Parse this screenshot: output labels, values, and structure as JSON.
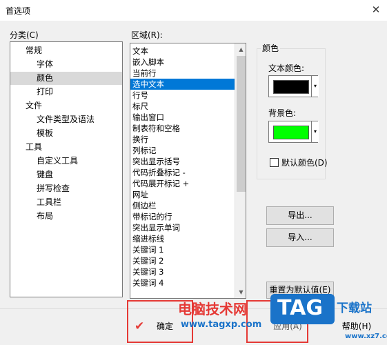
{
  "window": {
    "title": "首选项",
    "close_glyph": "✕"
  },
  "category": {
    "label": "分类(C)",
    "items": [
      {
        "label": "常规"
      },
      {
        "label": "字体"
      },
      {
        "label": "颜色"
      },
      {
        "label": "打印"
      },
      {
        "label": "文件"
      },
      {
        "label": "文件类型及语法"
      },
      {
        "label": "模板"
      },
      {
        "label": "工具"
      },
      {
        "label": "自定义工具"
      },
      {
        "label": "键盘"
      },
      {
        "label": "拼写检查"
      },
      {
        "label": "工具栏"
      },
      {
        "label": "布局"
      }
    ],
    "selected": "颜色"
  },
  "region": {
    "label": "区域(R):",
    "items": [
      {
        "label": "文本"
      },
      {
        "label": "嵌入脚本"
      },
      {
        "label": "当前行"
      },
      {
        "label": "选中文本"
      },
      {
        "label": "行号"
      },
      {
        "label": "标尺"
      },
      {
        "label": "输出窗口"
      },
      {
        "label": "制表符和空格"
      },
      {
        "label": "换行"
      },
      {
        "label": "列标记"
      },
      {
        "label": "突出显示括号"
      },
      {
        "label": "代码折叠标记 -"
      },
      {
        "label": "代码展开标记 +"
      },
      {
        "label": "网址"
      },
      {
        "label": "侧边栏"
      },
      {
        "label": "带标记的行"
      },
      {
        "label": "突出显示单词"
      },
      {
        "label": "缩进标线"
      },
      {
        "label": "关键词 1"
      },
      {
        "label": "关键词 2"
      },
      {
        "label": "关键词 3"
      },
      {
        "label": "关键词 4"
      }
    ],
    "selected": "选中文本"
  },
  "colors": {
    "group_label": "颜色",
    "text_color_label": "文本颜色:",
    "text_color": "#000000",
    "bg_color_label": "背景色:",
    "bg_color": "#00ff00",
    "default_checkbox_label": "默认颜色(D)",
    "default_checked": false
  },
  "buttons": {
    "export": "导出...",
    "import": "导入...",
    "reset": "重置为默认值(E)",
    "ok": "确定",
    "apply": "应用(A)",
    "help": "帮助(H)"
  },
  "watermark": {
    "site_name": "电脑技术网",
    "url": "www.tagxp.com",
    "logo_text": "TAG",
    "logo_sub": "下载站",
    "logo_url": "www.xz7.com"
  },
  "theme": {
    "selection_blue": "#0078d7",
    "highlight_red": "#e53935",
    "logo_blue": "#1a73c9"
  }
}
